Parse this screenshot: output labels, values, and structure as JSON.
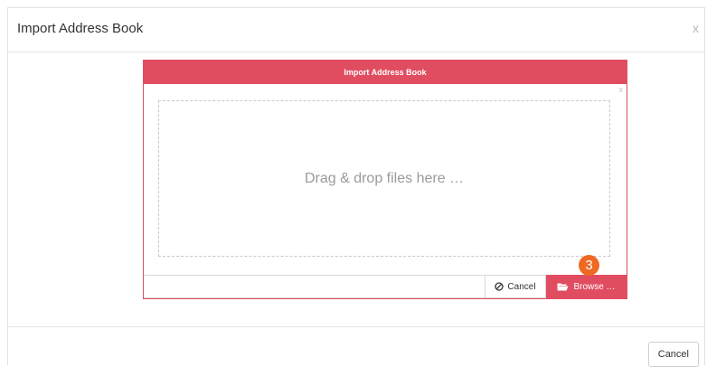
{
  "modal": {
    "title": "Import Address Book",
    "close_glyph": "x",
    "footer_cancel_label": "Cancel"
  },
  "panel": {
    "title": "Import Address Book",
    "close_glyph": "x",
    "dropzone_text": "Drag & drop files here …",
    "cancel_label": "Cancel",
    "browse_label": "Browse …"
  },
  "annotation": {
    "step_number": "3"
  },
  "colors": {
    "accent": "#e04d61",
    "badge": "#ee6a23"
  },
  "icons": {
    "cancel": "ban-icon",
    "browse": "folder-open-icon"
  }
}
